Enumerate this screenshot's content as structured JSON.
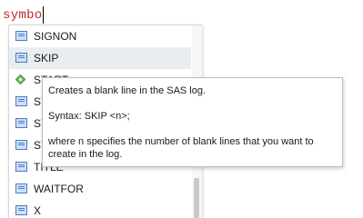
{
  "editor": {
    "typed_text": "symbo"
  },
  "autocomplete": {
    "items": [
      {
        "label": "SIGNON",
        "icon": "statement-icon"
      },
      {
        "label": "SKIP",
        "icon": "statement-icon",
        "selected": true
      },
      {
        "label": "START",
        "icon": "macro-diamond-icon"
      },
      {
        "label": "SY",
        "icon": "statement-icon"
      },
      {
        "label": "SY",
        "icon": "statement-icon"
      },
      {
        "label": "SY",
        "icon": "statement-icon"
      },
      {
        "label": "TITLE",
        "icon": "statement-icon"
      },
      {
        "label": "WAITFOR",
        "icon": "statement-icon"
      },
      {
        "label": "X",
        "icon": "statement-icon"
      }
    ]
  },
  "tooltip": {
    "description": "Creates a blank line in the SAS log.",
    "syntax": "Syntax: SKIP <n>;",
    "detail_line1": "where n specifies the number of blank lines that you want to",
    "detail_line2": "create in the log."
  },
  "colors": {
    "typed_text": "#c0282a",
    "selected_row": "#e9edf2",
    "icon_fill": "#cfe0f5",
    "icon_border": "#4a7bc4"
  }
}
